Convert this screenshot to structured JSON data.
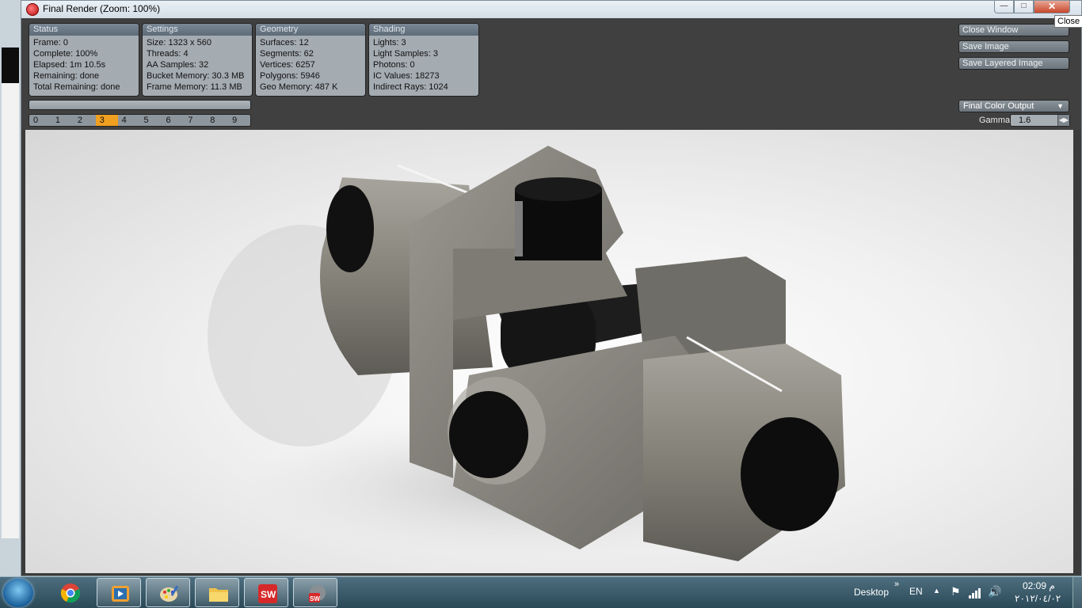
{
  "window": {
    "title": "Final Render (Zoom: 100%)",
    "tooltip": "Close"
  },
  "status": {
    "header": "Status",
    "rows": [
      "Frame: 0",
      "Complete: 100%",
      "Elapsed: 1m 10.5s",
      "Remaining: done",
      "Total Remaining: done"
    ]
  },
  "settings": {
    "header": "Settings",
    "rows": [
      "Size: 1323 x 560",
      "Threads: 4",
      "AA Samples: 32",
      "Bucket Memory: 30.3 MB",
      "Frame Memory: 11.3 MB"
    ]
  },
  "geometry": {
    "header": "Geometry",
    "rows": [
      "Surfaces: 12",
      "Segments: 62",
      "Vertices: 6257",
      "Polygons: 5946",
      "Geo Memory: 487 K"
    ]
  },
  "shading": {
    "header": "Shading",
    "rows": [
      "Lights: 3",
      "Light Samples: 3",
      "Photons: 0",
      "IC Values: 18273",
      "Indirect Rays: 1024"
    ]
  },
  "frames": {
    "labels": [
      "0",
      "1",
      "2",
      "3",
      "4",
      "5",
      "6",
      "7",
      "8",
      "9"
    ],
    "selected_index": 3
  },
  "actions": {
    "close_window": "Close Window",
    "save_image": "Save Image",
    "save_layered_image": "Save Layered Image"
  },
  "output": {
    "selected": "Final Color Output",
    "gamma_label": "Gamma",
    "gamma_value": "1.6"
  },
  "colors": {
    "selected_frame": "#f0a020",
    "part_body": "#8c8a83",
    "cap": "#111111"
  },
  "taskbar": {
    "icons": [
      "start-orb-icon",
      "chrome-icon",
      "media-player-icon",
      "paint-icon",
      "file-explorer-icon",
      "solidworks-icon",
      "photoview-icon"
    ],
    "desktop_label": "Desktop",
    "language": "EN",
    "time": "02:09 م",
    "date": "٢٠١٢/٠٤/٠٢"
  }
}
